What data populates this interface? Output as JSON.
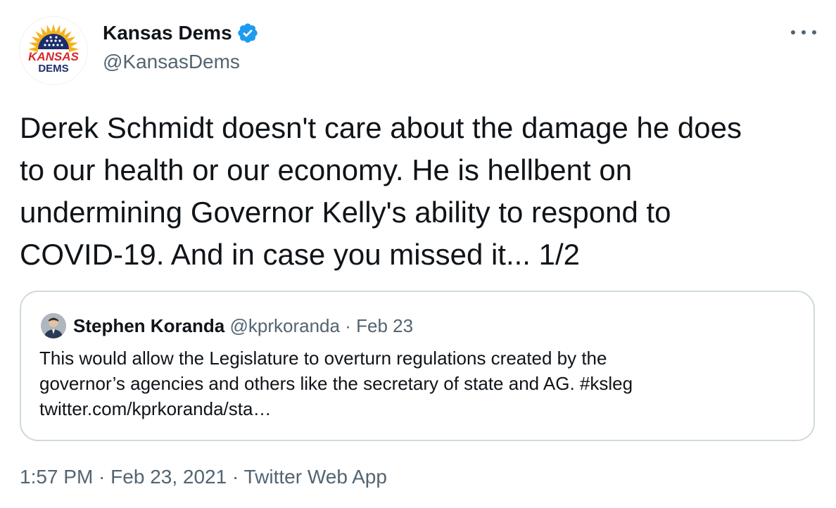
{
  "tweet": {
    "author_name": "Kansas Dems",
    "author_handle": "@KansasDems",
    "avatar_text_line1": "KANSAS",
    "avatar_text_line2": "DEMS",
    "text": "Derek Schmidt doesn't care about the damage he does\nto our health or our economy. He is hellbent on\nundermining Governor Kelly's ability to respond to\nCOVID-19. And in case you missed it... 1/2",
    "time": "1:57 PM",
    "date": "Feb 23, 2021",
    "source": "Twitter Web App",
    "separator": "·"
  },
  "quote": {
    "author_name": "Stephen Koranda",
    "author_handle": "@kprkoranda",
    "separator": "·",
    "date": "Feb 23",
    "text": "This would allow the Legislature to overturn regulations created by the\ngovernor’s agencies and others like the secretary of state and AG. #ksleg\ntwitter.com/kprkoranda/sta…"
  },
  "icons": {
    "verified": "verified-badge-icon",
    "more": "more-dots-icon"
  },
  "colors": {
    "verified_blue": "#1d9bf0",
    "text_primary": "#0f1419",
    "text_secondary": "#536471",
    "border": "#cfd9de",
    "logo_red": "#d6262b",
    "logo_navy": "#1c2d6b",
    "logo_gold": "#f5b21b"
  }
}
